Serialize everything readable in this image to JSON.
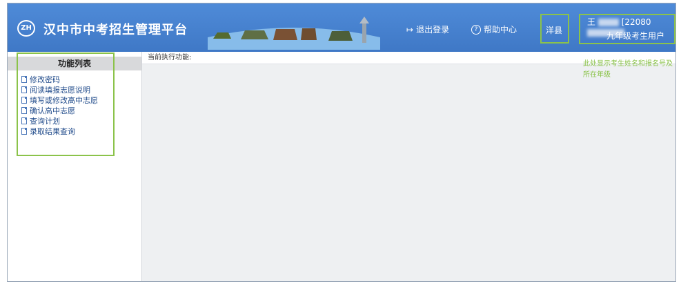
{
  "header": {
    "logo_text": "ZH",
    "title": "汉中市中考招生管理平台",
    "logout_label": "退出登录",
    "help_label": "帮助中心",
    "county": "洋县",
    "user_name": "王",
    "user_id": "[22080",
    "user_role": "九年级考生用户"
  },
  "sidebar": {
    "title": "功能列表",
    "items": [
      {
        "label": "修改密码"
      },
      {
        "label": "阅读填报志愿说明"
      },
      {
        "label": "填写或修改高中志愿"
      },
      {
        "label": "确认高中志愿"
      },
      {
        "label": "查询计划"
      },
      {
        "label": "录取结果查询"
      }
    ]
  },
  "main": {
    "current_function_label": "当前执行功能:"
  },
  "annotation": {
    "text": "此处显示考生姓名和报名号及所在年级"
  },
  "colors": {
    "header_blue": "#3f78c6",
    "highlight_green": "#8bc34a"
  }
}
